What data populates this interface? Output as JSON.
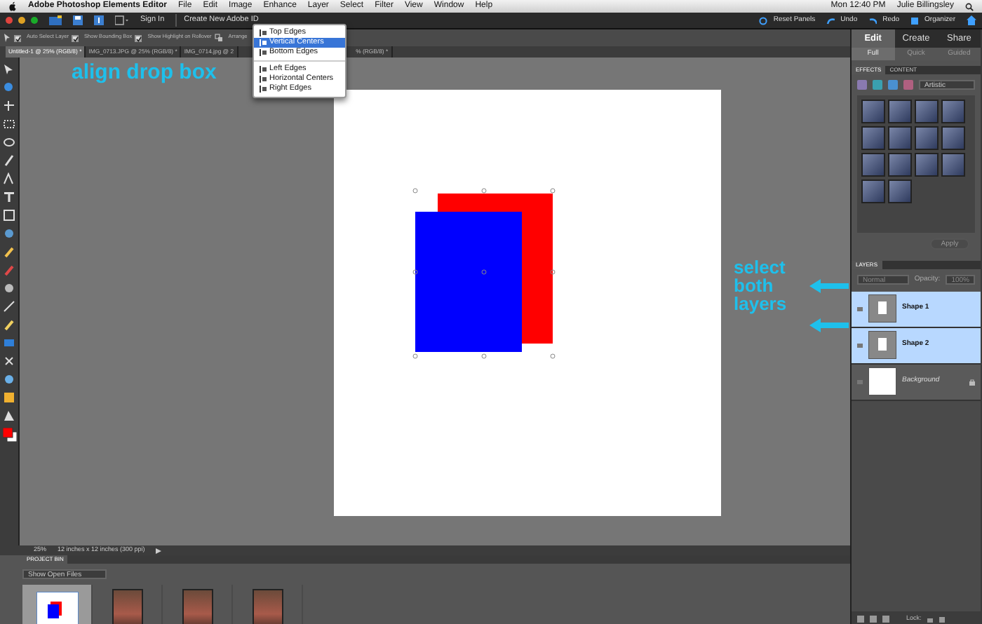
{
  "menubar": {
    "app": "Adobe Photoshop Elements Editor",
    "menus": [
      "File",
      "Edit",
      "Image",
      "Enhance",
      "Layer",
      "Select",
      "Filter",
      "View",
      "Window",
      "Help"
    ],
    "clock": "Mon 12:40 PM",
    "user": "Julie Billingsley"
  },
  "appbar": {
    "links": [
      "Sign In",
      "Create New Adobe ID"
    ],
    "actions": [
      {
        "kind": "reset",
        "label": "Reset Panels"
      },
      {
        "kind": "undo",
        "label": "Undo"
      },
      {
        "kind": "redo",
        "label": "Redo"
      },
      {
        "kind": "organizer",
        "label": "Organizer"
      }
    ]
  },
  "options": [
    {
      "label": "Auto Select Layer",
      "checked": true
    },
    {
      "label": "Show Bounding Box",
      "checked": true
    },
    {
      "label": "Show Highlight on Rollover",
      "checked": true
    }
  ],
  "arrange_label": "Arrange",
  "doc_tabs": [
    {
      "label": "Untitled-1 @ 25% (RGB/8) *",
      "selected": true
    },
    {
      "label": "IMG_0713.JPG @ 25% (RGB/8) *",
      "selected": false
    },
    {
      "label": "IMG_0714.jpg @ 2",
      "selected": false
    },
    {
      "label": "% (RGB/8) *",
      "selected": false
    }
  ],
  "align_menu": {
    "groups": [
      [
        {
          "label": "Top Edges",
          "selected": false
        },
        {
          "label": "Vertical Centers",
          "selected": true
        },
        {
          "label": "Bottom Edges",
          "selected": false
        }
      ],
      [
        {
          "label": "Left Edges",
          "selected": false
        },
        {
          "label": "Horizontal Centers",
          "selected": false
        },
        {
          "label": "Right Edges",
          "selected": false
        }
      ]
    ]
  },
  "annotations": {
    "menu_note": "align drop box",
    "layers_note": "select both layers"
  },
  "mode_tabs": [
    {
      "label": "Edit",
      "selected": true
    },
    {
      "label": "Create",
      "selected": false
    },
    {
      "label": "Share",
      "selected": false
    }
  ],
  "edit_modes": [
    {
      "label": "Full",
      "selected": true
    },
    {
      "label": "Quick",
      "selected": false
    },
    {
      "label": "Guided",
      "selected": false
    }
  ],
  "panel_tabs": [
    {
      "label": "EFFECTS",
      "selected": true
    },
    {
      "label": "CONTENT",
      "selected": false
    }
  ],
  "effect_category": "Artistic",
  "apply": "Apply",
  "layers": {
    "title": "LAYERS",
    "blend_mode": "Normal",
    "opacity_label": "Opacity:",
    "opacity": "100%",
    "lock_label": "Lock:",
    "items": [
      {
        "name": "Shape 1",
        "kind": "shape",
        "selected": true
      },
      {
        "name": "Shape 2",
        "kind": "shape",
        "selected": true
      },
      {
        "name": "Background",
        "kind": "background",
        "selected": false
      }
    ]
  },
  "status": {
    "zoom": "25%",
    "doc_size": "12 inches x 12 inches (300 ppi)"
  },
  "project_bin": {
    "title": "PROJECT BIN",
    "filter": "Show Open Files",
    "files": [
      {
        "kind": "document",
        "selected": true
      },
      {
        "kind": "photo",
        "selected": false
      },
      {
        "kind": "photo",
        "selected": false
      },
      {
        "kind": "photo",
        "selected": false
      }
    ]
  }
}
